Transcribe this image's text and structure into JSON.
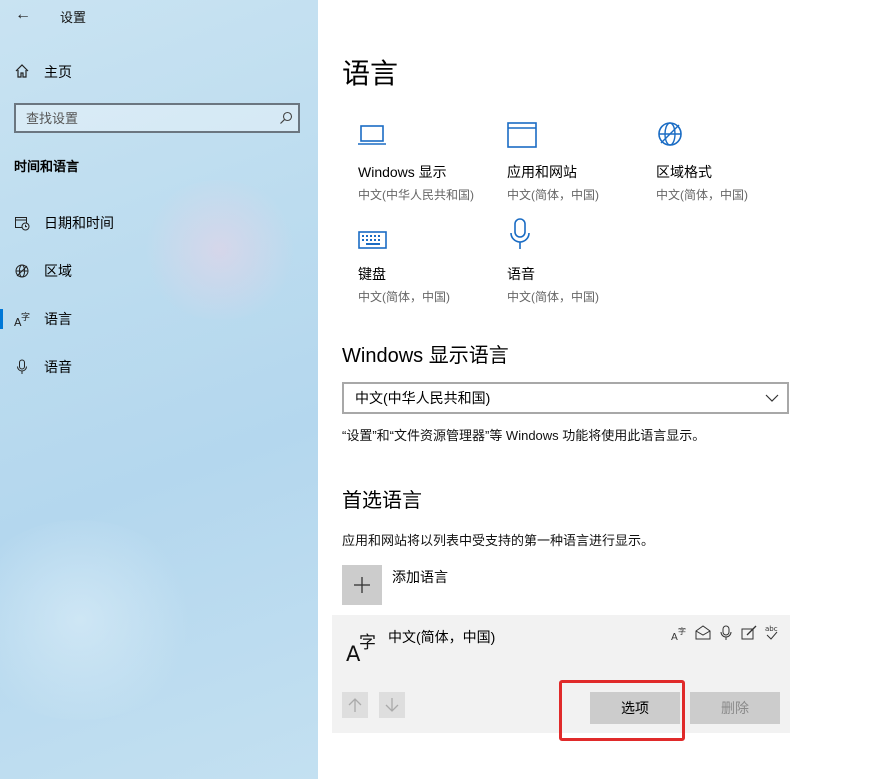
{
  "window": {
    "title": "设置",
    "back_glyph": "←"
  },
  "sidebar": {
    "home_label": "主页",
    "search_placeholder": "查找设置",
    "section_title": "时间和语言",
    "items": [
      {
        "label": "日期和时间",
        "icon": "calendar-clock-icon",
        "active": false
      },
      {
        "label": "区域",
        "icon": "globe-icon",
        "active": false
      },
      {
        "label": "语言",
        "icon": "language-icon",
        "active": true
      },
      {
        "label": "语音",
        "icon": "microphone-icon",
        "active": false
      }
    ]
  },
  "main": {
    "title": "语言",
    "tiles": [
      {
        "name": "Windows 显示",
        "desc": "中文(中华人民共和国)",
        "icon": "monitor-icon"
      },
      {
        "name": "应用和网站",
        "desc": "中文(简体，中国)",
        "icon": "window-icon"
      },
      {
        "name": "区域格式",
        "desc": "中文(简体，中国)",
        "icon": "globe-icon"
      },
      {
        "name": "键盘",
        "desc": "中文(简体，中国)",
        "icon": "keyboard-icon"
      },
      {
        "name": "语音",
        "desc": "中文(简体，中国)",
        "icon": "microphone-icon"
      }
    ],
    "display_language": {
      "heading": "Windows 显示语言",
      "selected": "中文(中华人民共和国)",
      "note": "“设置”和“文件资源管理器”等 Windows 功能将使用此语言显示。"
    },
    "preferred": {
      "heading": "首选语言",
      "note": "应用和网站将以列表中受支持的第一种语言进行显示。",
      "add_label": "添加语言",
      "language": {
        "name": "中文(简体，中国)",
        "features": [
          "language-pack-icon",
          "text-to-speech-icon",
          "speech-recognition-icon",
          "handwriting-icon",
          "spellcheck-icon"
        ]
      },
      "options_label": "选项",
      "remove_label": "删除"
    },
    "highlight_color": "#e02a2a",
    "accent": "#0078d7"
  }
}
